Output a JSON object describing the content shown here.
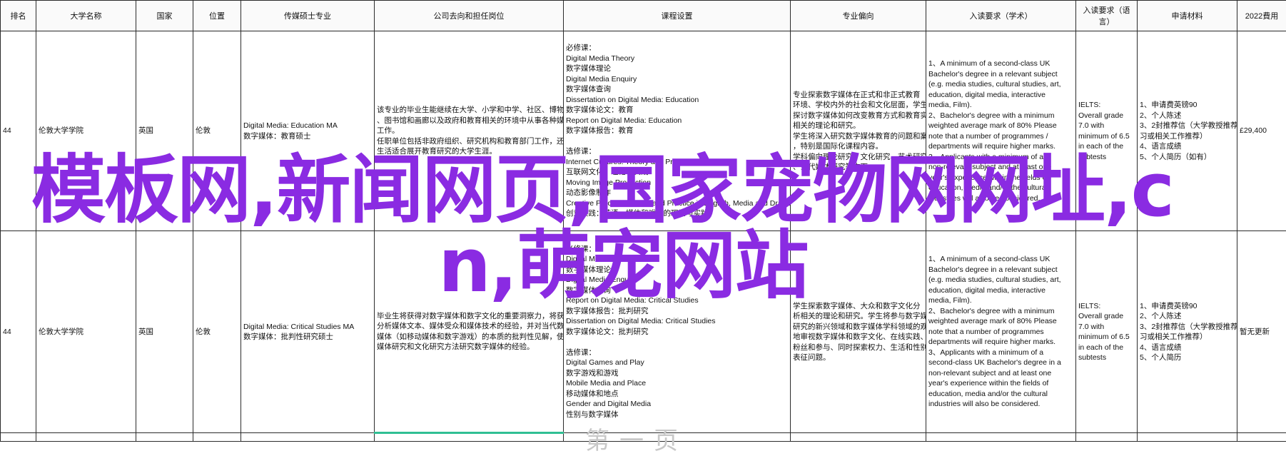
{
  "headers": [
    "排名",
    "大学名称",
    "国家",
    "位置",
    "传媒硕士专业",
    "公司去向和担任岗位",
    "课程设置",
    "专业偏向",
    "入读要求（学术）",
    "入读要求（语言）",
    "申请材料",
    "2022費用"
  ],
  "rows": [
    {
      "rank": "44",
      "university": "伦敦大学学院",
      "country": "英国",
      "location": "伦敦",
      "program": [
        "Digital Media: Education MA",
        "数字媒体：教育硕士"
      ],
      "careers": [
        "该专业的毕业生能继续在大学、小学和中学、社区、博物馆",
        "、图书馆和画廊以及政府和教育相关的环境中从事各种媒体教育",
        "工作。",
        "任职单位包括非政府组织、研究机构和教育部门工作，还从事",
        "生活适合展开教育研究的大学生涯。"
      ],
      "courses": [
        "必修课：",
        "Digital Media Theory",
        "数字媒体理论",
        "Digital Media Enquiry",
        "数字媒体查询",
        "Dissertation on Digital Media: Education",
        "数字媒体论文：教育",
        "Report on Digital Media: Education",
        "数字媒体报告：教育",
        "",
        "选修课：",
        "Internet Cultures: Theory and Practice",
        "互联网文化：理论与实践",
        "Moving Image Production",
        "动态影像制作",
        "Creative Practice: Theory and Practice in English, Media and Drama",
        "创意实践：英语、媒体和戏剧的理论与实践"
      ],
      "focus": [
        "专业探索数字媒体在正式和非正式教育",
        "环境、学校内外的社会和文化层面，学生能",
        "探讨数字媒体如何改变教育方式和教育实践",
        "相关的理论和研究。",
        "学生将深入研究数字媒体教育的问题和案例",
        "，特别是国际化课程内容。",
        "学科偏向理论研究、文化研究、艺术研究",
        "、当代媒体研究等方面。"
      ],
      "academic": [
        "1、A minimum of a second-class UK",
        "Bachelor's degree in a relevant subject",
        "(e.g. media studies, cultural studies, art,",
        "education, digital media, interactive",
        "media, Film).",
        "2、Bachelor's degree with a minimum",
        "weighted average mark of 80% Please",
        "note that a number of programmes /",
        "departments will require higher marks.",
        "3、Applicants with a minimum of a",
        "non-relevant subject and at least one",
        "year's experience within the fields of",
        "education, media and/or the cultural",
        "industries will also be considered."
      ],
      "language": [
        "IELTS:",
        "Overall grade",
        "7.0 with",
        "minimum of 6.5",
        "in each of the",
        "subtests"
      ],
      "materials": [
        "1、申请费英镑90",
        "2、个人陈述",
        "3、2封推荐信（大学教授推荐或实",
        "习或相关工作推荐）",
        "4、语言成绩",
        "5、个人简历（如有）"
      ],
      "fee": "£29,400"
    },
    {
      "rank": "44",
      "university": "伦敦大学学院",
      "country": "英国",
      "location": "伦敦",
      "program": [
        "Digital Media: Critical Studies MA",
        "数字媒体：批判性研究硕士"
      ],
      "careers": [
        "毕业生将获得对数字媒体和数字文化的重要洞察力，将获得",
        "分析媒体文本、媒体受众和媒体技术的经验，并对当代数字",
        "媒体（如移动媒体和数字游戏）的本质的批判性见解，使用",
        "媒体研究和文化研究方法研究数字媒体的经验。"
      ],
      "courses": [
        "必修课：",
        "Digital Media Theory",
        "数字媒体理论",
        "Digital Media Enquiry",
        "数字媒体查询",
        "Report on Digital Media: Critical Studies",
        "数字媒体报告：批判研究",
        "Dissertation on Digital Media: Critical Studies",
        "数字媒体论文：批判研究",
        "",
        "选修课：",
        "Digital Games and Play",
        "数字游戏和游戏",
        "Mobile Media and Place",
        "移动媒体和地点",
        "Gender and Digital Media",
        "性别与数字媒体"
      ],
      "focus": [
        "学生探索数字媒体、大众和数字文化分",
        "析相关的理论和研究。学生将参与数字媒体",
        "研究的新兴领域和数字媒体学科领域的观点，批判性",
        "地审视数字媒体和数字文化、在线实践、",
        "粉丝和参与、同时探索权力、生活和性别化",
        "表征问题。"
      ],
      "academic": [
        "1、A minimum of a second-class UK",
        "Bachelor's degree in a relevant subject",
        "(e.g. media studies, cultural studies, art,",
        "education, digital media, interactive",
        "media, Film).",
        "2、Bachelor's degree with a minimum",
        "weighted average mark of 80% Please",
        "note that a number of programmes",
        "departments will require higher marks.",
        "3、Applicants with a minimum of a",
        "second-class UK Bachelor's degree in a",
        "non-relevant subject and at least one",
        "year's experience within the fields of",
        "education, media and/or the cultural",
        "industries will also be considered."
      ],
      "language": [
        "IELTS:",
        "Overall grade",
        "7.0 with",
        "minimum of 6.5",
        "in each of the",
        "subtests"
      ],
      "materials": [
        "1、申请费英镑90",
        "2、个人陈述",
        "3、2封推荐信（大学教授推荐或实",
        "习或相关工作推荐）",
        "4、语言成绩",
        "5、个人简历"
      ],
      "fee": "暂无更新"
    }
  ],
  "watermark": {
    "line1": "模板网,新闻网页,国家宠物网网址,c",
    "line2": "n,萌宠网站",
    "color": "#8a2be2"
  },
  "ghost_text": "第一页"
}
